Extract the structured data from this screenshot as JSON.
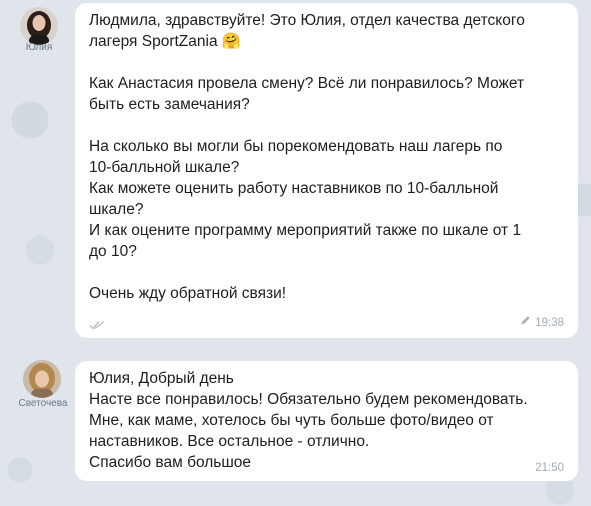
{
  "messages": [
    {
      "sender": "Юлия",
      "avatar_icon": "woman-dark-hair-avatar",
      "paragraphs": [
        [
          "Людмила, здравствуйте! Это Юлия, отдел качества детского",
          "лагеря SportZania 🤗"
        ],
        [
          "Как Анастасия провела смену? Всё ли понравилось? Может",
          "быть есть замечания?"
        ],
        [
          "На сколько вы могли бы порекомендовать наш лагерь по",
          "10-балльной шкале?",
          "Как можете оценить работу наставников по 10-балльной",
          "шкале?",
          "И как оцените программу мероприятий также по шкале от 1",
          "до 10?"
        ],
        [
          "Очень жду обратной связи!"
        ]
      ],
      "time": "19:38",
      "edited_icon": "pencil-icon",
      "status_icon": "double-check-icon"
    },
    {
      "sender": "Светочева",
      "avatar_icon": "woman-light-hair-avatar",
      "lines": [
        "Юлия, Добрый день",
        "Насте все понравилось! Обязательно будем рекомендовать.",
        "Мне, как маме, хотелось бы чуть больше фото/видео от",
        "наставников. Все остальное - отлично.",
        "Спасибо вам большое"
      ],
      "time": "21:50"
    }
  ],
  "colors": {
    "bubble": "#ffffff",
    "background": "#dfe5eb",
    "meta_text": "#a3acb5"
  }
}
